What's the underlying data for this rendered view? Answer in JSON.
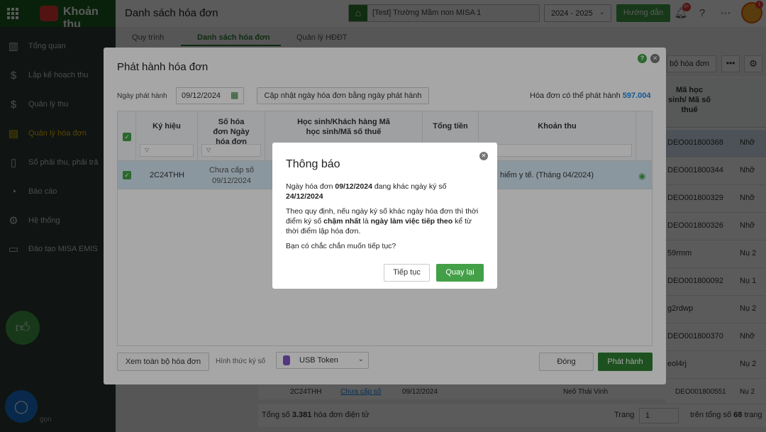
{
  "app": {
    "name": "Khoản thu",
    "page_title": "Danh sách hóa đơn"
  },
  "topbar": {
    "school": "[Test] Trường Mầm non MISA 1",
    "year": "2024 - 2025",
    "guide_label": "Hướng dẫn",
    "bell_badge": "9+",
    "avatar_badge": "1"
  },
  "sidebar": {
    "items": [
      {
        "label": "Tổng quan",
        "icon": "chart-icon"
      },
      {
        "label": "Lập kế hoạch thu",
        "icon": "plan-icon"
      },
      {
        "label": "Quản lý thu",
        "icon": "money-hand-icon"
      },
      {
        "label": "Quản lý hóa đơn",
        "icon": "invoice-icon"
      },
      {
        "label": "Sổ phải thu, phải trả",
        "icon": "ledger-icon"
      },
      {
        "label": "Báo cáo",
        "icon": "report-icon"
      },
      {
        "label": "Hệ thống",
        "icon": "gear-icon"
      },
      {
        "label": "Đào tạo MISA EMIS",
        "icon": "book-icon"
      }
    ],
    "footer": "gọn"
  },
  "background": {
    "tabs": [
      "Quy trình",
      "Danh sách hóa đơn",
      "Quản lý HĐĐT"
    ],
    "view_all_short": "bộ hóa đơn",
    "column_header": "Mã học sinh/ Mã số thuế",
    "rows": [
      {
        "code": "DEO001800368",
        "tail": "Nhỡ"
      },
      {
        "code": "DEO001800344",
        "tail": "Nhỡ"
      },
      {
        "code": "DEO001800329",
        "tail": "Nhỡ"
      },
      {
        "code": "DEO001800326",
        "tail": "Nhỡ"
      },
      {
        "code": "59rmm",
        "tail": "Nụ 2"
      },
      {
        "code": "DEO001800092",
        "tail": "Nụ 1"
      },
      {
        "code": "g2rdwp",
        "tail": "Nụ 2"
      },
      {
        "code": "DEO001800370",
        "tail": "Nhỡ"
      },
      {
        "code": "eol4rj",
        "tail": "Nụ 2"
      }
    ],
    "bottom_row": {
      "symbol": "2C24THH",
      "status": "Chưa cấp số",
      "date": "09/12/2024",
      "name": "Neô Thái Vinh",
      "code": "DEO001800551",
      "tail": "Nụ 2"
    },
    "footer": {
      "total_prefix": "Tổng số",
      "total_count": "3.381",
      "total_suffix": "hóa đơn điện tử",
      "page_label": "Trang",
      "page_value": "1",
      "page_of": "trên tổng số",
      "page_total": "68",
      "page_suffix": "trang"
    }
  },
  "dialog": {
    "title": "Phát hành hóa đơn",
    "date_label": "Ngày phát hành",
    "date_value": "09/12/2024",
    "update_button": "Cập nhật ngày hóa đơn bằng ngày phát hành",
    "available_label": "Hóa đơn có thể phát hành",
    "available_count": "597.004",
    "columns": {
      "symbol": "Ký hiệu",
      "number_date": "Số hóa đơn Ngày hóa đơn",
      "student": "Học sinh/Khách hàng Mã học sinh/Mã số thuế",
      "total": "Tổng tiền",
      "fee": "Khoản thu"
    },
    "row": {
      "symbol": "2C24THH",
      "number": "Chưa cấp số",
      "date": "09/12/2024",
      "fee": "hiểm y tế. (Tháng 04/2024)"
    },
    "view_all_button": "Xem toàn bộ hóa đơn",
    "sign_method_label": "Hình thức ký số",
    "sign_method_value": "USB Token",
    "close_button": "Đóng",
    "issue_button": "Phát hành"
  },
  "confirm": {
    "title": "Thông báo",
    "p1_a": "Ngày hóa đơn ",
    "p1_b": "09/12/2024",
    "p1_c": " đang khác ngày ký số ",
    "p1_d": "24/12/2024",
    "p2_a": "Theo quy định, nếu ngày ký số khác ngày hóa đơn thì thời điểm ký số ",
    "p2_b": "chậm nhất",
    "p2_c": " là ",
    "p2_d": "ngày làm việc tiếp theo",
    "p2_e": " kể từ thời điểm lập hóa đơn.",
    "p3": "Bạn có chắc chắn muốn tiếp tục?",
    "continue_button": "Tiếp tục",
    "back_button": "Quay lại"
  }
}
